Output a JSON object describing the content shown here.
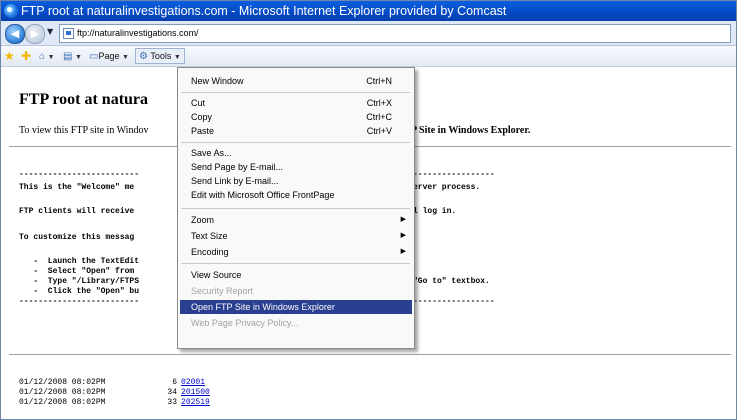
{
  "window": {
    "title": "FTP root at naturalinvestigations.com - Microsoft Internet Explorer provided by Comcast",
    "address": "ftp://naturalinvestigations.com/"
  },
  "cmdbar": {
    "page_label": "Page",
    "tools_label": "Tools"
  },
  "page": {
    "title": "FTP root at natura",
    "intro_left": "To view this FTP site in Windov",
    "intro_right": "P Site in Windows Explorer.",
    "msg_lines": [
      "This is the \"Welcome\" me",
      "FTP clients will receive",
      "To customize this messag"
    ],
    "msg_right": [
      "erver process.",
      "l log in."
    ],
    "bullet_lines": [
      "   -  Launch the TextEdit",
      "   -  Select \"Open\" from",
      "   -  Type \"/Library/FTPS",
      "   -  Click the \"Open\" bu"
    ],
    "bullet_right": "\"Go to\" textbox.",
    "dashes_left": "-------------------------",
    "dashes_right": "-----------------",
    "listing": [
      {
        "date": "01/12/2008 08:02PM",
        "size": "6",
        "name": "02001"
      },
      {
        "date": "01/12/2008 08:02PM",
        "size": "34",
        "name": "201500"
      },
      {
        "date": "01/12/2008 08:02PM",
        "size": "33",
        "name": "202519"
      }
    ]
  },
  "menu": {
    "items": [
      {
        "label": "New Window",
        "shortcut": "Ctrl+N"
      },
      {
        "label": "Cut",
        "shortcut": "Ctrl+X"
      },
      {
        "label": "Copy",
        "shortcut": "Ctrl+C"
      },
      {
        "label": "Paste",
        "shortcut": "Ctrl+V"
      },
      {
        "label": "Save As...",
        "shortcut": ""
      },
      {
        "label": "Send Page by E-mail...",
        "shortcut": ""
      },
      {
        "label": "Send Link by E-mail...",
        "shortcut": ""
      },
      {
        "label": "Edit with Microsoft Office FrontPage",
        "shortcut": ""
      },
      {
        "label": "Zoom",
        "shortcut": ""
      },
      {
        "label": "Text Size",
        "shortcut": ""
      },
      {
        "label": "Encoding",
        "shortcut": ""
      },
      {
        "label": "View Source",
        "shortcut": ""
      },
      {
        "label": "Security Report",
        "shortcut": ""
      },
      {
        "label": "Open FTP Site in Windows Explorer",
        "shortcut": ""
      },
      {
        "label": "Web Page Privacy Policy...",
        "shortcut": ""
      }
    ]
  },
  "colors": {
    "titlebar": "#0649c2",
    "menu_highlight": "#2a3f8f",
    "link": "#0000cc",
    "disabled": "#a3a3a3"
  },
  "icons": [
    "ie-icon",
    "back-icon",
    "forward-icon",
    "page-icon",
    "favorites-star-icon",
    "add-favorites-icon",
    "home-icon",
    "print-icon",
    "tools-icon",
    "submenu-arrow-icon"
  ]
}
